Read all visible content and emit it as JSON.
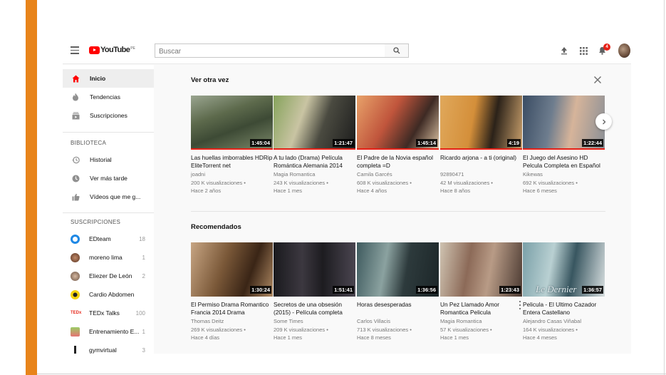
{
  "header": {
    "logo_text": "YouTube",
    "logo_country": "PE",
    "search_placeholder": "Buscar",
    "notification_count": "4",
    "icons": [
      "menu-icon",
      "search-icon",
      "upload-icon",
      "apps-icon",
      "bell-icon"
    ],
    "brand_color": "#ff0000"
  },
  "sidebar": {
    "nav": [
      {
        "label": "Inicio",
        "icon": "home-icon",
        "active": true
      },
      {
        "label": "Tendencias",
        "icon": "fire-icon"
      },
      {
        "label": "Suscripciones",
        "icon": "subscriptions-icon"
      }
    ],
    "library_heading": "BIBLIOTECA",
    "library": [
      {
        "label": "Historial",
        "icon": "history-icon"
      },
      {
        "label": "Ver más tarde",
        "icon": "clock-icon"
      },
      {
        "label": "Vídeos que me g...",
        "icon": "thumbs-up-icon"
      }
    ],
    "subs_heading": "SUSCRIPCIONES",
    "subscriptions": [
      {
        "label": "EDteam",
        "count": "18",
        "color": "#1e88e5"
      },
      {
        "label": "moreno lima",
        "count": "1",
        "color": "#7a4a33"
      },
      {
        "label": "Eliezer De León",
        "count": "2",
        "color": "#8d6e63"
      },
      {
        "label": "Cardio Abdomen",
        "count": "",
        "color": "#f5d40f"
      },
      {
        "label": "TEDx Talks",
        "count": "100",
        "color": "#e62b1e"
      },
      {
        "label": "Entrenamiento E...",
        "count": "1",
        "color": "#9ccc65"
      },
      {
        "label": "gymvirtual",
        "count": "3",
        "color": "#222222"
      }
    ]
  },
  "main": {
    "sections": [
      {
        "title": "Ver otra vez",
        "videos": [
          {
            "title": "Las huellas imborrables HDRip EliteTorrent net",
            "channel": "joadni",
            "views": "200 K visualizaciones •",
            "age": "Hace 2 años",
            "duration": "1:45:04",
            "thumb": "linear-gradient(160deg,#9aa590 0%,#5d6a4c 35%,#3d4a35 60%,#7d8a6a 100%)"
          },
          {
            "title": "A tu lado (Drama) Película Romántica Alemania 2014",
            "channel": "Magia Romantica",
            "views": "243 K visualizaciones •",
            "age": "Hace 1 mes",
            "duration": "1:21:47",
            "thumb": "linear-gradient(110deg,#86a35c 0%,#c9c4a3 35%,#4a4a40 60%,#1c1c1c 100%)"
          },
          {
            "title": "El Padre de la Novia español completa =D",
            "channel": "Camila Garcés",
            "views": "608 K visualizaciones •",
            "age": "Hace 4 años",
            "duration": "1:45:14",
            "thumb": "linear-gradient(120deg,#e8a26a 0%,#c0553c 40%,#3e2a24 70%,#e2c9a8 100%)"
          },
          {
            "title": "Ricardo arjona - a ti (original)",
            "channel": "92890471",
            "views": "42 M visualizaciones •",
            "age": "Hace 8 años",
            "duration": "4:19",
            "thumb": "linear-gradient(100deg,#e0a85b 0%,#d48f3a 40%,#2b2219 65%,#c9a06c 100%)"
          },
          {
            "title": "El Juego del Asesino HD Pelcula Completa en Español",
            "channel": "Kikewas",
            "views": "692 K visualizaciones •",
            "age": "Hace 6 meses",
            "duration": "1:22:44",
            "thumb": "linear-gradient(100deg,#3a4c63 0%,#6e7d8e 35%,#d6b49a 60%,#8a8f96 100%)"
          }
        ]
      },
      {
        "title": "Recomendados",
        "videos": [
          {
            "title": "El Permiso Drama Romantico Francia 2014 Drama",
            "channel": "Thomas Deitz",
            "views": "269 K visualizaciones •",
            "age": "Hace 4 días",
            "duration": "1:30:24",
            "thumb": "linear-gradient(110deg,#c7a583 0%,#7a5838 40%,#3a2516 70%,#b08a63 100%)"
          },
          {
            "title": "Secretos de una obsesión (2015) - Película completa",
            "channel": "Some Times",
            "views": "209 K visualizaciones •",
            "age": "Hace 1 mes",
            "duration": "1:51:41",
            "thumb": "linear-gradient(90deg,#1a1a1e 0%,#3c3840 35%,#1d1c20 60%,#4a4550 100%)"
          },
          {
            "title": "Horas desesperadas",
            "channel": "Carlos Villacis",
            "views": "713 K visualizaciones •",
            "age": "Hace 8 meses",
            "duration": "1:36:56",
            "thumb": "linear-gradient(100deg,#3e5a5e 0%,#8ba2a0 35%,#2d3a3c 60%,#1c2628 100%)"
          },
          {
            "title": "Un Pez Llamado Amor Romantica Pelicula Alemania",
            "channel": "Magia Romantica",
            "views": "57 K visualizaciones •",
            "age": "Hace 1 mes",
            "duration": "1:23:43",
            "thumb": "linear-gradient(100deg,#cfc3b1 0%,#8c6a58 35%,#b89b86 60%,#4b3a32 100%)"
          },
          {
            "title": "Pelicula - El Ultimo Cazador Entera Castellano",
            "channel": "Alejandro Casas Viñabal",
            "views": "164 K visualizaciones •",
            "age": "Hace 4 meses",
            "duration": "1:36:57",
            "thumb": "linear-gradient(100deg,#7aa0a8 0%,#b9d0d2 35%,#385660 60%,#d8dfe0 100%)",
            "thumb_text": "Le Dernier"
          }
        ]
      }
    ]
  }
}
